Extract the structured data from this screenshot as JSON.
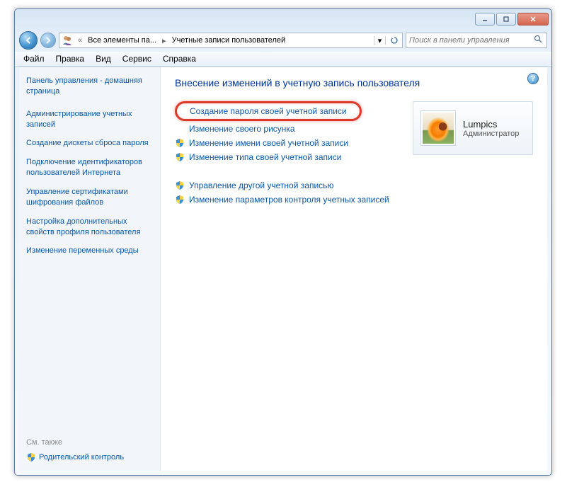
{
  "titlebar": {
    "minimize": "Свернуть",
    "maximize": "Развернуть",
    "close": "Закрыть"
  },
  "breadcrumb": {
    "seg1": "Все элементы па...",
    "seg2": "Учетные записи пользователей"
  },
  "search": {
    "placeholder": "Поиск в панели управления"
  },
  "menubar": {
    "file": "Файл",
    "edit": "Правка",
    "view": "Вид",
    "service": "Сервис",
    "help": "Справка"
  },
  "sidebar": {
    "home": "Панель управления - домашняя страница",
    "tasks": [
      "Администрирование учетных записей",
      "Создание дискеты сброса пароля",
      "Подключение идентификаторов пользователей Интернета",
      "Управление сертификатами шифрования файлов",
      "Настройка дополнительных свойств профиля пользователя",
      "Изменение переменных среды"
    ],
    "see_also": "См. также",
    "parental": "Родительский контроль"
  },
  "main": {
    "heading": "Внесение изменений в учетную запись пользователя",
    "highlighted_link": "Создание пароля своей учетной записи",
    "links_group1": [
      {
        "label": "Изменение своего рисунка",
        "shield": false
      },
      {
        "label": "Изменение имени своей учетной записи",
        "shield": true
      },
      {
        "label": "Изменение типа своей учетной записи",
        "shield": true
      }
    ],
    "links_group2": [
      {
        "label": "Управление другой учетной записью",
        "shield": true
      },
      {
        "label": "Изменение параметров контроля учетных записей",
        "shield": true
      }
    ],
    "user": {
      "name": "Lumpics",
      "role": "Администратор"
    }
  }
}
